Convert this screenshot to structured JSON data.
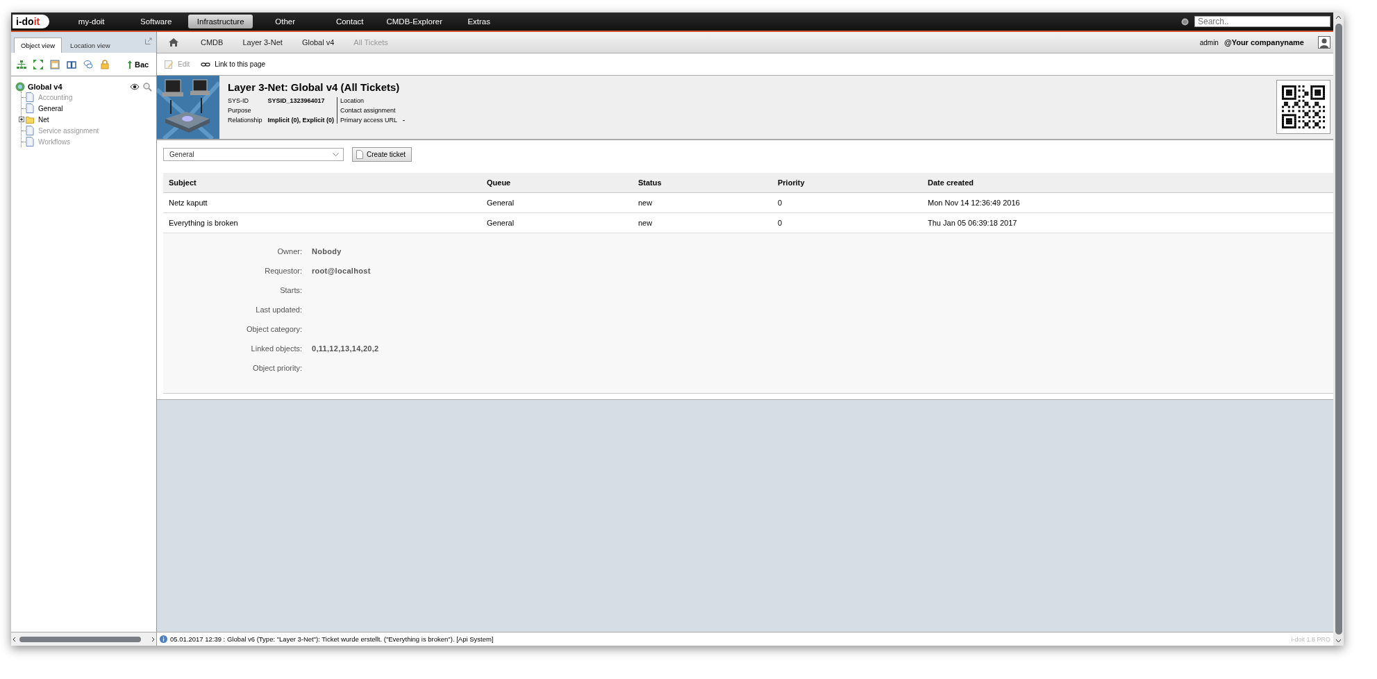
{
  "top_nav": {
    "logo": [
      "i-do",
      "it"
    ],
    "menu": [
      {
        "label": "my-doit",
        "selected": false
      },
      {
        "label": "Software",
        "selected": false
      },
      {
        "label": "Infrastructure",
        "selected": true
      },
      {
        "label": "Other",
        "selected": false
      },
      {
        "label": "Contact",
        "selected": false
      },
      {
        "label": "CMDB-Explorer",
        "selected": false
      },
      {
        "label": "Extras",
        "selected": false
      }
    ],
    "search": {
      "placeholder": "Search.."
    }
  },
  "sidebar": {
    "tabs": [
      {
        "label": "Object view",
        "selected": true
      },
      {
        "label": "Location view",
        "selected": false
      }
    ],
    "toolbar_text": "Bac",
    "tree": {
      "label": "Global v4",
      "children": [
        {
          "label": "Accounting",
          "kind": "page",
          "disabled": true
        },
        {
          "label": "General",
          "kind": "page",
          "disabled": false
        },
        {
          "label": "Net",
          "kind": "folder",
          "disabled": false,
          "expanded": false
        },
        {
          "label": "Service assignment",
          "kind": "page",
          "disabled": true
        },
        {
          "label": "Workflows",
          "kind": "page",
          "disabled": true
        }
      ]
    }
  },
  "breadcrumb": [
    {
      "label": "CMDB",
      "current": false
    },
    {
      "label": "Layer 3-Net",
      "current": false
    },
    {
      "label": "Global v4",
      "current": false
    },
    {
      "label": "All Tickets",
      "current": true
    }
  ],
  "user": {
    "name": "admin",
    "company": "@Your companyname"
  },
  "actions": [
    {
      "label": "Edit",
      "disabled": true,
      "kind": "edit"
    },
    {
      "label": "Link to this page",
      "disabled": false,
      "kind": "link"
    }
  ],
  "header": {
    "title": "Layer 3-Net: Global v4 (All Tickets)",
    "fields_left": [
      {
        "label": "SYS-ID",
        "value": "SYSID_1323964017"
      },
      {
        "label": "Purpose"
      },
      {
        "label": "Relationship",
        "value": "Implicit (0), Explicit (0)"
      }
    ],
    "fields_right": [
      {
        "label": "Location"
      },
      {
        "label": "Contact assignment"
      },
      {
        "label": "Primary access URL",
        "value": "-"
      }
    ]
  },
  "queue_select": {
    "value": "General"
  },
  "create_button": "Create ticket",
  "table": {
    "columns": [
      "Subject",
      "Queue",
      "Status",
      "Priority",
      "Date created"
    ],
    "rows": [
      [
        "Netz kaputt",
        "General",
        "new",
        "0",
        "Mon Nov 14 12:36:49 2016"
      ],
      [
        "Everything is broken",
        "General",
        "new",
        "0",
        "Thu Jan 05 06:39:18 2017"
      ]
    ]
  },
  "details": [
    {
      "label": "Owner:",
      "value": "Nobody"
    },
    {
      "label": "Requestor:",
      "value": "root@localhost"
    },
    {
      "label": "Starts:"
    },
    {
      "label": "Last updated:"
    },
    {
      "label": "Object category:"
    },
    {
      "label": "Linked objects:",
      "value": "0,11,12,13,14,20,2"
    },
    {
      "label": "Object priority:"
    }
  ],
  "status_bar": {
    "message": "05.01.2017 12:39 : Global v6 (Type: \"Layer 3-Net\"): Ticket wurde erstellt. (\"Everything is broken\"). [Api System]",
    "version": "i-doit 1.8 PRO"
  }
}
